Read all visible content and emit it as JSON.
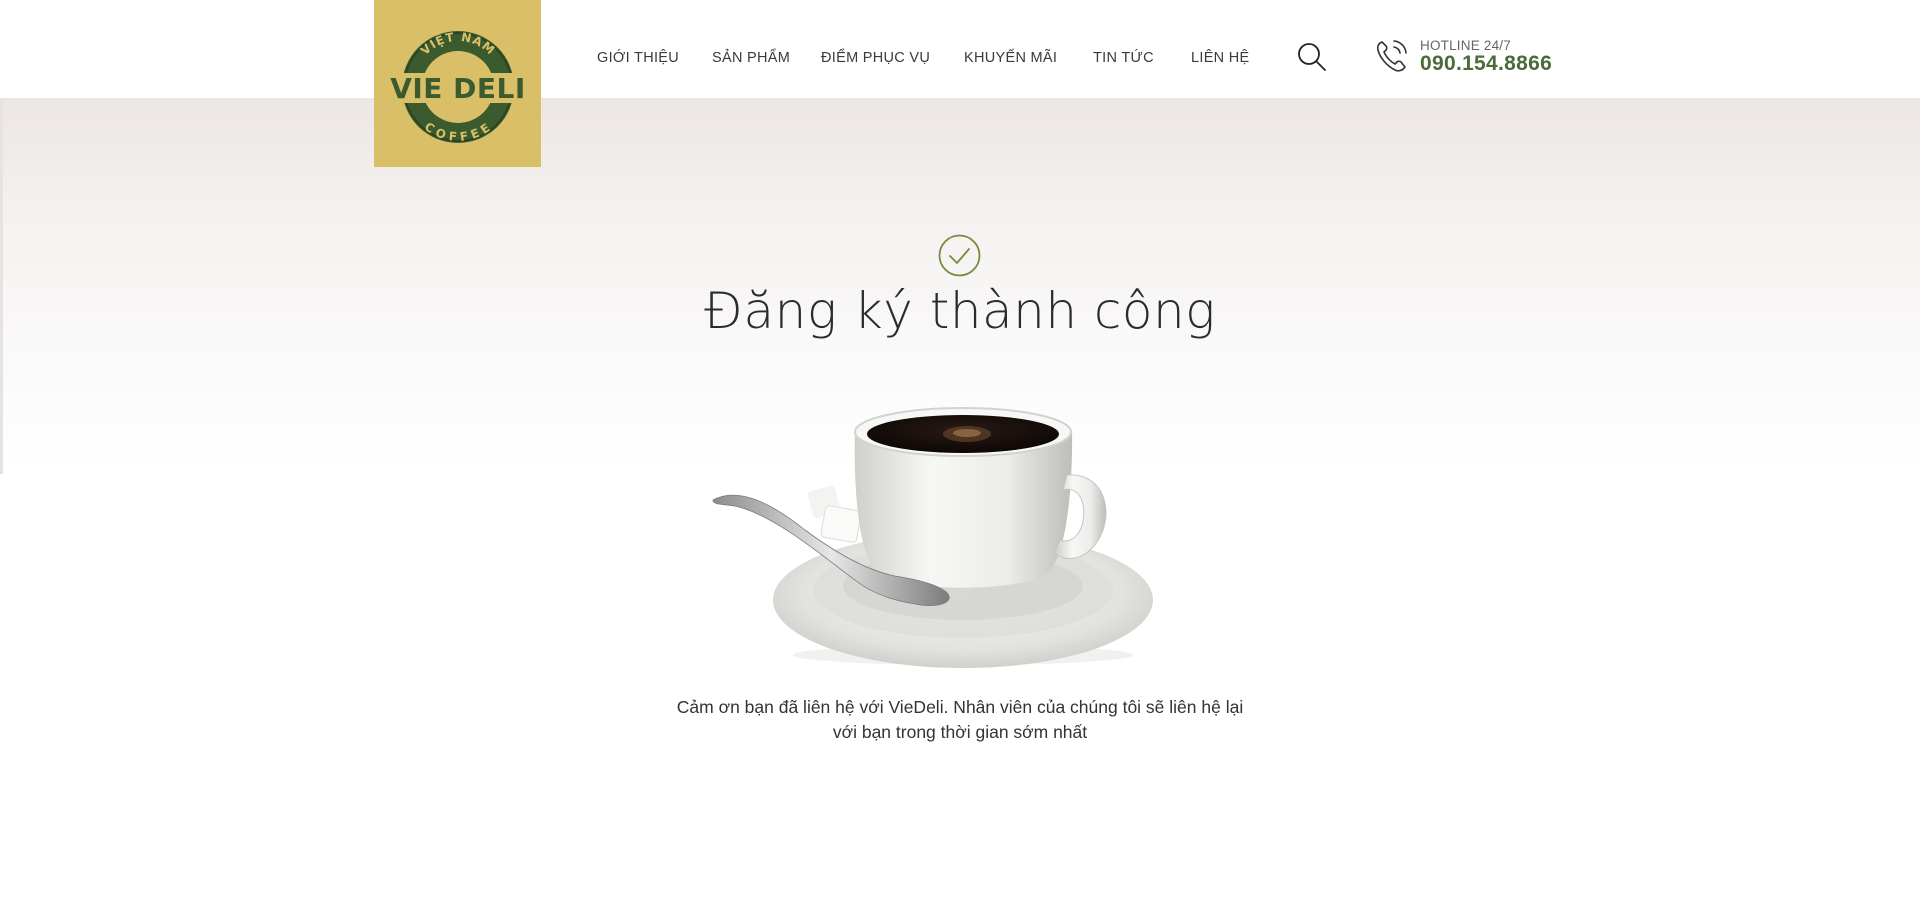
{
  "header": {
    "logo": {
      "top_text": "VIỆT NAM",
      "main_text": "VIE DELI",
      "bottom_text": "COFFEE"
    },
    "nav": [
      {
        "label": "GIỚI THIỆU"
      },
      {
        "label": "SẢN PHẨM"
      },
      {
        "label": "ĐIỂM PHỤC VỤ"
      },
      {
        "label": "KHUYẾN MÃI"
      },
      {
        "label": "TIN TỨC"
      },
      {
        "label": "LIÊN HỆ"
      }
    ],
    "search_icon": "search-icon",
    "hotline": {
      "label": "HOTLINE 24/7",
      "number": "090.154.8866",
      "icon": "phone-icon"
    }
  },
  "main": {
    "status_icon": "check-circle-icon",
    "title": "Đăng ký thành công",
    "message_line1": "Cảm ơn bạn đã liên hệ với VieDeli. Nhân viên của chúng tôi sẽ liên hệ lại",
    "message_line2": "với bạn trong thời gian sớm nhất"
  },
  "colors": {
    "logo_bg": "#d9bf68",
    "brand_green": "#4a6b3a",
    "check_green": "#7a8a3a",
    "text_dark": "#2b2b2b"
  }
}
